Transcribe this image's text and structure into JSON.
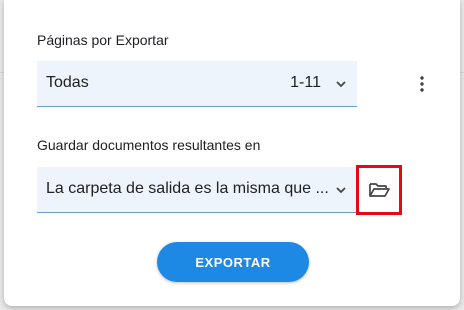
{
  "pages_section": {
    "label": "Páginas por Exportar",
    "selected": "Todas",
    "range": "1-11"
  },
  "save_section": {
    "label": "Guardar documentos resultantes en",
    "selected": "La carpeta de salida es la misma que ..."
  },
  "export_button": {
    "label": "EXPORTAR"
  },
  "icons": {
    "dropdown": "chevron-down-icon",
    "more": "more-vert-icon",
    "folder": "folder-open-icon"
  },
  "colors": {
    "accent": "#1e88e5",
    "field_bg": "#eef4fb",
    "highlight": "#e50914"
  }
}
